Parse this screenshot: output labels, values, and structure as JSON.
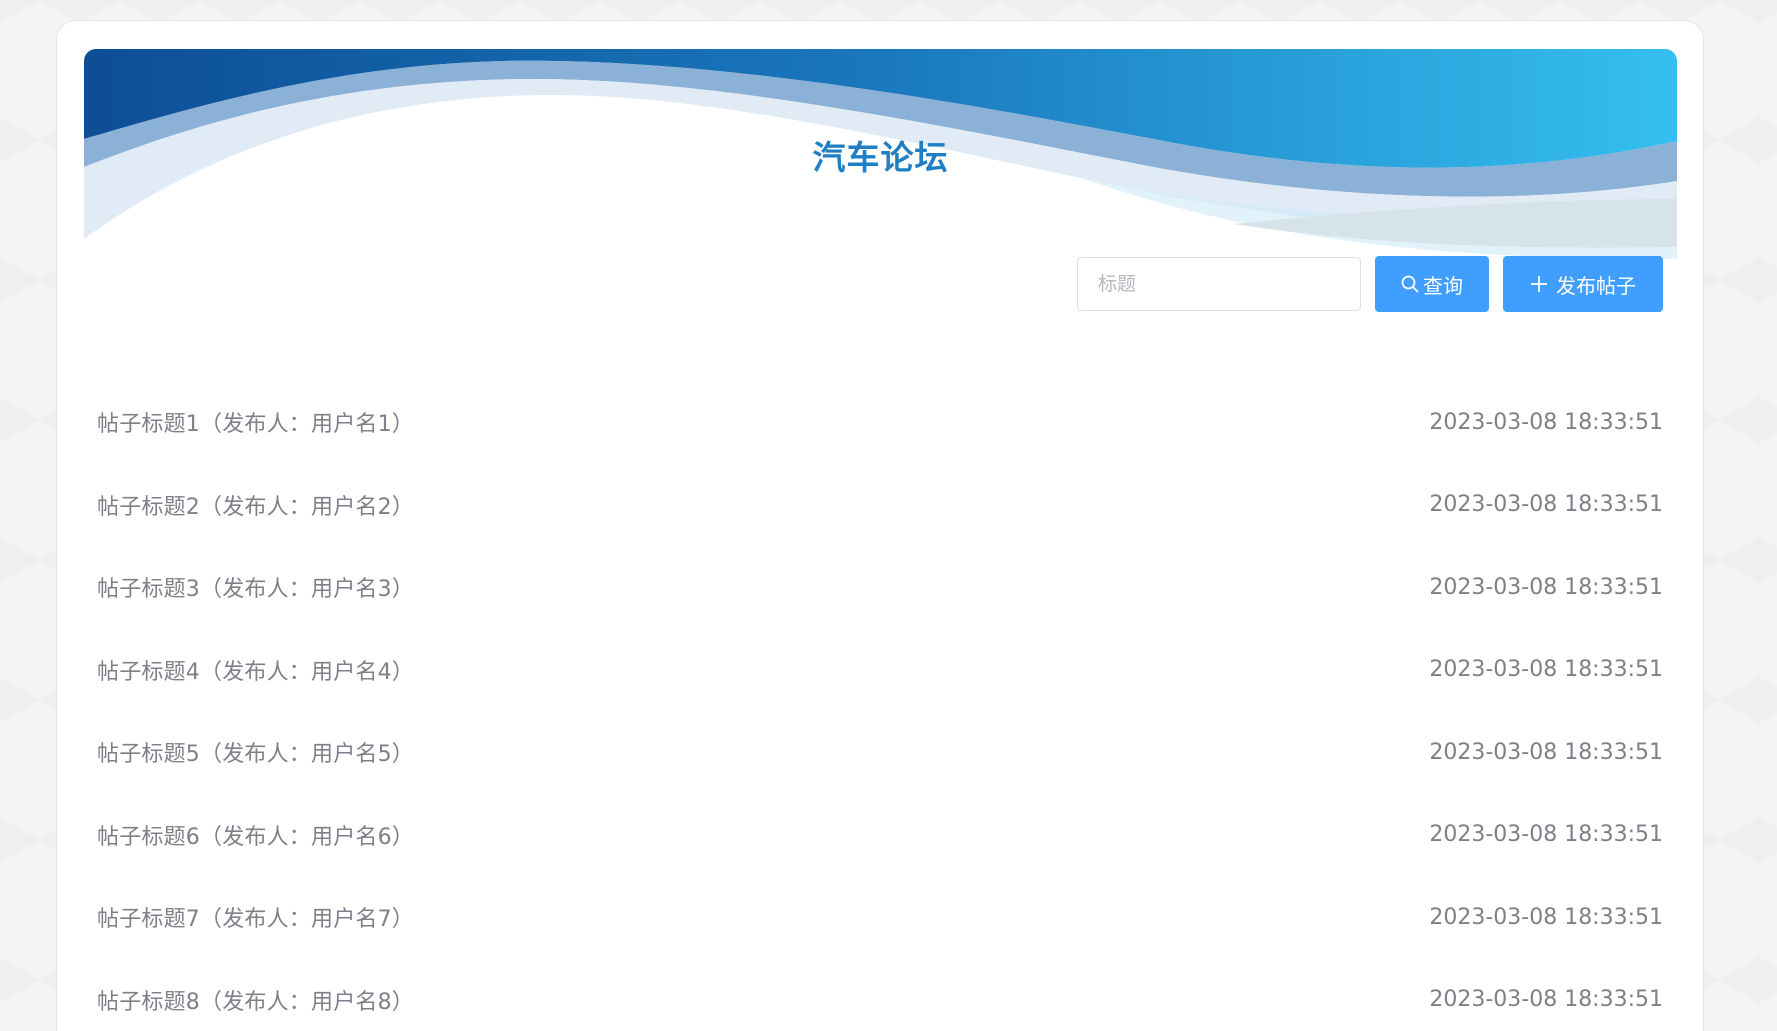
{
  "banner": {
    "title": "汽车论坛",
    "colors": {
      "dark_blue": "#0d4e96",
      "light_blue": "#35bff0",
      "title_blue": "#1f7fc4"
    }
  },
  "toolbar": {
    "search_placeholder": "标题",
    "search_value": "",
    "search_button_label": "查询",
    "publish_button_label": "发布帖子",
    "button_color": "#409eff"
  },
  "posts": [
    {
      "title": "帖子标题1（发布人：用户名1）",
      "time": "2023-03-08 18:33:51"
    },
    {
      "title": "帖子标题2（发布人：用户名2）",
      "time": "2023-03-08 18:33:51"
    },
    {
      "title": "帖子标题3（发布人：用户名3）",
      "time": "2023-03-08 18:33:51"
    },
    {
      "title": "帖子标题4（发布人：用户名4）",
      "time": "2023-03-08 18:33:51"
    },
    {
      "title": "帖子标题5（发布人：用户名5）",
      "time": "2023-03-08 18:33:51"
    },
    {
      "title": "帖子标题6（发布人：用户名6）",
      "time": "2023-03-08 18:33:51"
    },
    {
      "title": "帖子标题7（发布人：用户名7）",
      "time": "2023-03-08 18:33:51"
    },
    {
      "title": "帖子标题8（发布人：用户名8）",
      "time": "2023-03-08 18:33:51"
    }
  ]
}
